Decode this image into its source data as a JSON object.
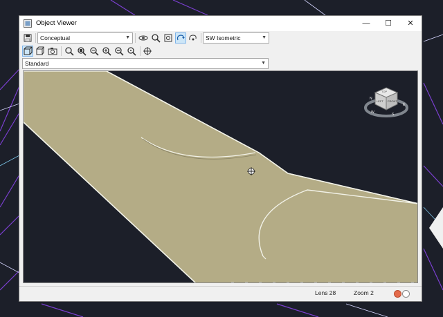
{
  "window": {
    "title": "Object Viewer",
    "minimize_glyph": "—",
    "maximize_glyph": "☐",
    "close_glyph": "✕"
  },
  "toolbar": {
    "visual_style": "Conceptual",
    "view_preset": "SW Isometric",
    "style_combo": "Standard"
  },
  "viewcube": {
    "faces": [
      "TOP",
      "FRONT",
      "LEFT"
    ],
    "compass": [
      "N",
      "E",
      "S",
      "W"
    ]
  },
  "status": {
    "lens": "Lens 28",
    "zoom": "Zoom 2"
  },
  "colors": {
    "surface": "#b4ac86",
    "edge": "#f2f2e8",
    "background": "#1c1f29"
  },
  "icons": [
    "save-icon",
    "orbit-icon",
    "zoom-icon",
    "view-icon",
    "pan-icon"
  ]
}
